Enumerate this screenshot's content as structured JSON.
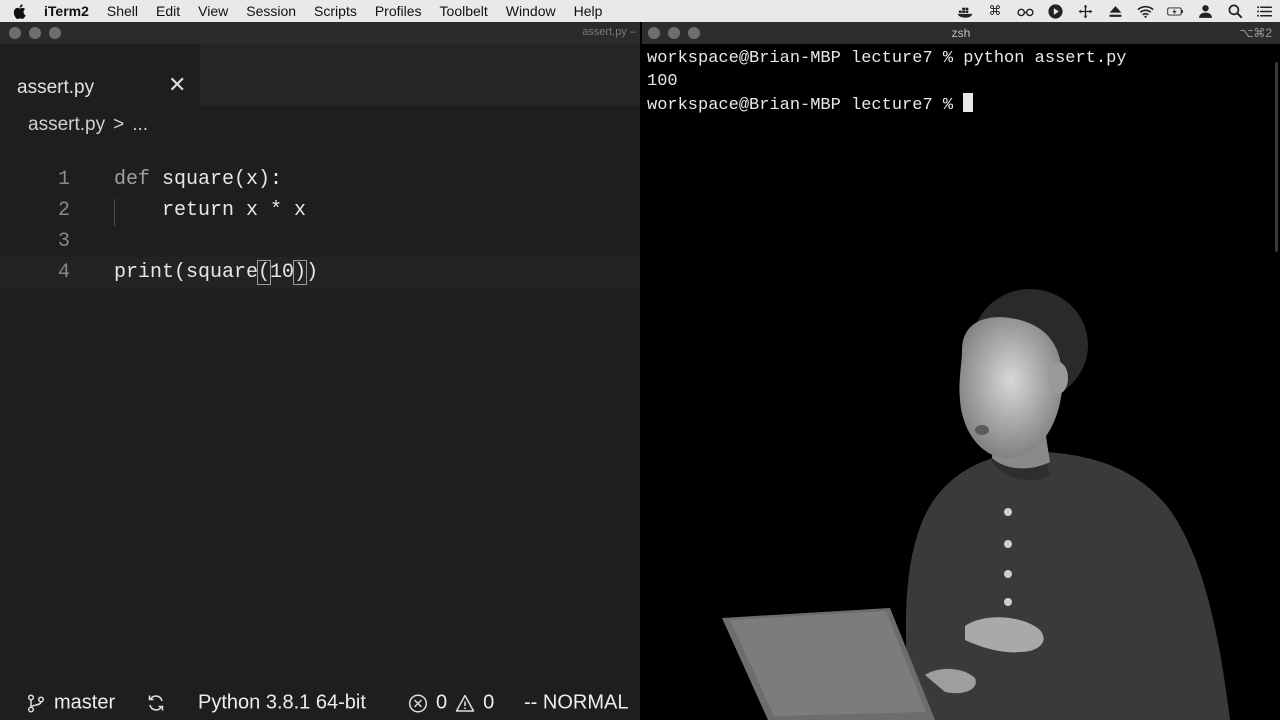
{
  "menubar": {
    "app": "iTerm2",
    "menus": [
      "Shell",
      "Edit",
      "View",
      "Session",
      "Scripts",
      "Profiles",
      "Toolbelt",
      "Window",
      "Help"
    ]
  },
  "editor": {
    "window_title": "assert.py –",
    "tab": {
      "name": "assert.py"
    },
    "breadcrumb": {
      "file": "assert.py",
      "separator": ">",
      "more": "..."
    },
    "lines": [
      {
        "num": "1",
        "kw": "def",
        "text": " square(x):"
      },
      {
        "num": "2",
        "text": "    return x * x"
      },
      {
        "num": "3",
        "text": ""
      },
      {
        "num": "4",
        "pre": "print(square",
        "b1": "(",
        "mid": "10",
        "b2": ")",
        "post": ")"
      }
    ],
    "status": {
      "branch": "master",
      "python": "Python 3.8.1 64-bit",
      "errors": "0",
      "warnings": "0",
      "mode": "-- NORMAL"
    }
  },
  "terminal": {
    "title": "zsh",
    "shortcut": "⌥⌘2",
    "lines": [
      "workspace@Brian-MBP lecture7 % python assert.py",
      "100",
      "workspace@Brian-MBP lecture7 % "
    ]
  },
  "colors": {
    "editor_bg": "#1e1e1e",
    "terminal_bg": "#000000",
    "menubar_bg": "#e9e9e9"
  }
}
